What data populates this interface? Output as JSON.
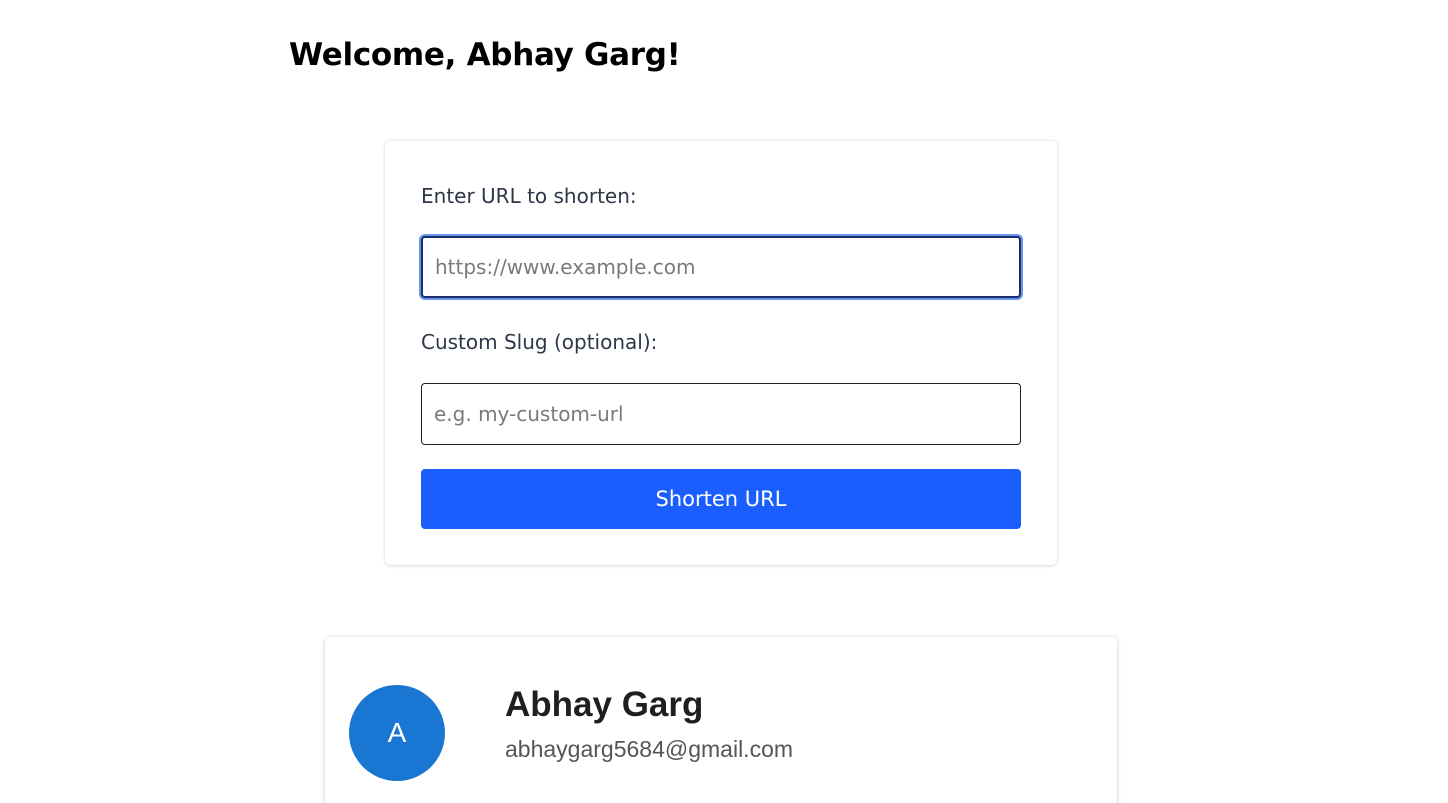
{
  "header": {
    "welcome_text": "Welcome, Abhay Garg!"
  },
  "shorten_form": {
    "url_label": "Enter URL to shorten:",
    "url_value": "",
    "url_placeholder": "https://www.example.com",
    "slug_label": "Custom Slug (optional):",
    "slug_value": "",
    "slug_placeholder": "e.g. my-custom-url",
    "submit_label": "Shorten URL"
  },
  "profile": {
    "avatar_initial": "A",
    "name": "Abhay Garg",
    "email": "abhaygarg5684@gmail.com"
  },
  "colors": {
    "primary_button": "#1a5ffd",
    "avatar_background": "#1976d2",
    "focus_ring": "#6a95e8"
  }
}
